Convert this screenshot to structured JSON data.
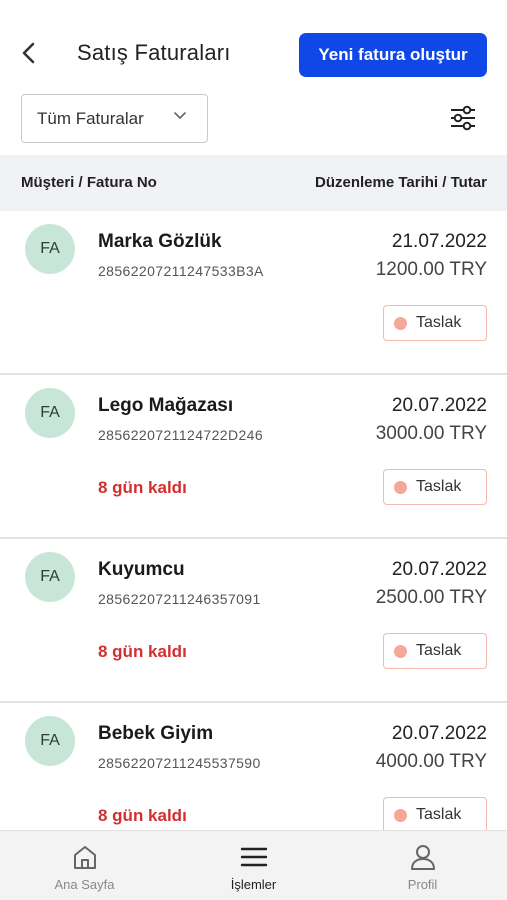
{
  "header": {
    "title": "Satış Faturaları",
    "new_invoice_label": "Yeni fatura oluştur",
    "back_icon": "chevron-left-icon",
    "accent_color": "#1048e8"
  },
  "filter": {
    "selected": "Tüm Faturalar",
    "settings_icon": "sliders-icon"
  },
  "table": {
    "col_left": "Müşteri / Fatura No",
    "col_right": "Düzenleme Tarihi / Tutar"
  },
  "invoices": [
    {
      "initials": "FA",
      "customer": "Marka Gözlük",
      "number": "28562207211247533B3A",
      "date": "21.07.2022",
      "amount": "1200.00 TRY",
      "days_left": "",
      "status": "Taslak"
    },
    {
      "initials": "FA",
      "customer": "Lego Mağazası",
      "number": "2856220721124722D246",
      "date": "20.07.2022",
      "amount": "3000.00 TRY",
      "days_left": "8 gün kaldı",
      "status": "Taslak"
    },
    {
      "initials": "FA",
      "customer": "Kuyumcu",
      "number": "28562207211246357091",
      "date": "20.07.2022",
      "amount": "2500.00 TRY",
      "days_left": "8 gün kaldı",
      "status": "Taslak"
    },
    {
      "initials": "FA",
      "customer": "Bebek Giyim",
      "number": "28562207211245537590",
      "date": "20.07.2022",
      "amount": "4000.00 TRY",
      "days_left": "8 gün kaldı",
      "status": "Taslak"
    }
  ],
  "tabs": [
    {
      "label": "Ana Sayfa",
      "icon": "home-icon",
      "active": false
    },
    {
      "label": "İşlemler",
      "icon": "menu-icon",
      "active": true
    },
    {
      "label": "Profil",
      "icon": "user-icon",
      "active": false
    }
  ]
}
